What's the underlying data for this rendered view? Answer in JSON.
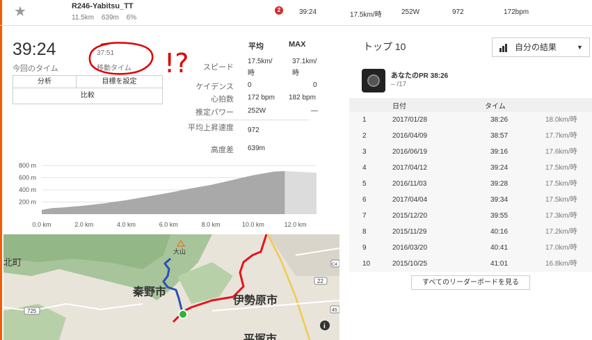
{
  "header": {
    "star_icon": "★",
    "segment_name": "R246-Yabitsu_TT",
    "distance": "11.5km",
    "elevation": "639m",
    "grade": "6%",
    "rank_badge": "2",
    "time": "39:24",
    "speed": "17.5km/時",
    "power": "252W",
    "value_972": "972",
    "heart_rate": "172bpm"
  },
  "summary": {
    "elapsed_time": "39:24",
    "elapsed_label": "今回のタイム",
    "moving_time": "37:51",
    "moving_label": "移動タイム",
    "annotation_marks": "!?",
    "buttons": {
      "analysis": "分析",
      "set_goal": "目標を設定",
      "compare": "比較"
    }
  },
  "stats": {
    "col_avg": "平均",
    "col_max": "MAX",
    "rows": [
      {
        "label": "スピード",
        "avg": "17.5km/時",
        "max": "37.1km/時"
      },
      {
        "label": "ケイデンス",
        "avg": "0",
        "max": "0"
      },
      {
        "label": "心拍数",
        "avg": "172 bpm",
        "max": "182 bpm"
      },
      {
        "label": "推定パワー",
        "avg": "252W",
        "max": "—"
      },
      {
        "label": "平均上昇速度",
        "avg": "972",
        "max": ""
      },
      {
        "label": "高度差",
        "avg": "639m",
        "max": ""
      }
    ]
  },
  "chart_data": {
    "type": "area",
    "x_unit": "km",
    "xlim": [
      0,
      13
    ],
    "ylim": [
      0,
      800
    ],
    "x_ticks": [
      "0.0 km",
      "2.0 km",
      "4.0 km",
      "6.0 km",
      "8.0 km",
      "10.0 km",
      "12.0 km"
    ],
    "y_ticks": [
      "800 m",
      "600 m",
      "400 m",
      "200 m"
    ],
    "series": [
      {
        "x": [
          0,
          0.5,
          1,
          2,
          3,
          4,
          5,
          6,
          7,
          8,
          9,
          10,
          11,
          11.5
        ],
        "values": [
          70,
          100,
          110,
          140,
          180,
          230,
          290,
          350,
          420,
          480,
          560,
          640,
          700,
          709
        ]
      },
      {
        "x": [
          11.5,
          12,
          12.5,
          13
        ],
        "values": [
          709,
          700,
          690,
          680
        ]
      }
    ],
    "grid": true
  },
  "leaderboard": {
    "title": "トップ 10",
    "filter_label": "自分の結果",
    "pr_label": "あなたのPR 38:26",
    "pr_rank": "– /17",
    "col_date": "日付",
    "col_time": "タイム",
    "rows": [
      {
        "rank": "1",
        "date": "2017/01/28",
        "time": "38:26",
        "speed": "18.0km/時"
      },
      {
        "rank": "2",
        "date": "2016/04/09",
        "time": "38:57",
        "speed": "17.7km/時"
      },
      {
        "rank": "3",
        "date": "2016/06/19",
        "time": "39:16",
        "speed": "17.6km/時"
      },
      {
        "rank": "4",
        "date": "2017/04/12",
        "time": "39:24",
        "speed": "17.5km/時"
      },
      {
        "rank": "5",
        "date": "2016/11/03",
        "time": "39:28",
        "speed": "17.5km/時"
      },
      {
        "rank": "6",
        "date": "2017/04/04",
        "time": "39:34",
        "speed": "17.5km/時"
      },
      {
        "rank": "7",
        "date": "2015/12/20",
        "time": "39:55",
        "speed": "17.3km/時"
      },
      {
        "rank": "8",
        "date": "2015/11/29",
        "time": "40:16",
        "speed": "17.2km/時"
      },
      {
        "rank": "9",
        "date": "2016/03/20",
        "time": "40:41",
        "speed": "17.0km/時"
      },
      {
        "rank": "10",
        "date": "2015/10/25",
        "time": "41:01",
        "speed": "16.8km/時"
      }
    ],
    "view_all_label": "すべてのリーダーボードを見る"
  },
  "map": {
    "labels": {
      "hadano": "秦野市",
      "isehara": "伊勢原市",
      "hiratsuka": "平塚市",
      "kitamachi": "北町",
      "oyama": "大山",
      "road_725": "725",
      "road_22": "22",
      "road_45": "45",
      "road_c4": "C4",
      "info": "i"
    }
  },
  "colors": {
    "accent": "#f35b04",
    "badge": "#d62b2b",
    "annotation": "#e00000",
    "elevation_fill": "#aaaaaa",
    "route_red": "#e4141b",
    "route_blue": "#2a4fb5",
    "start_marker": "#2fb23a"
  }
}
